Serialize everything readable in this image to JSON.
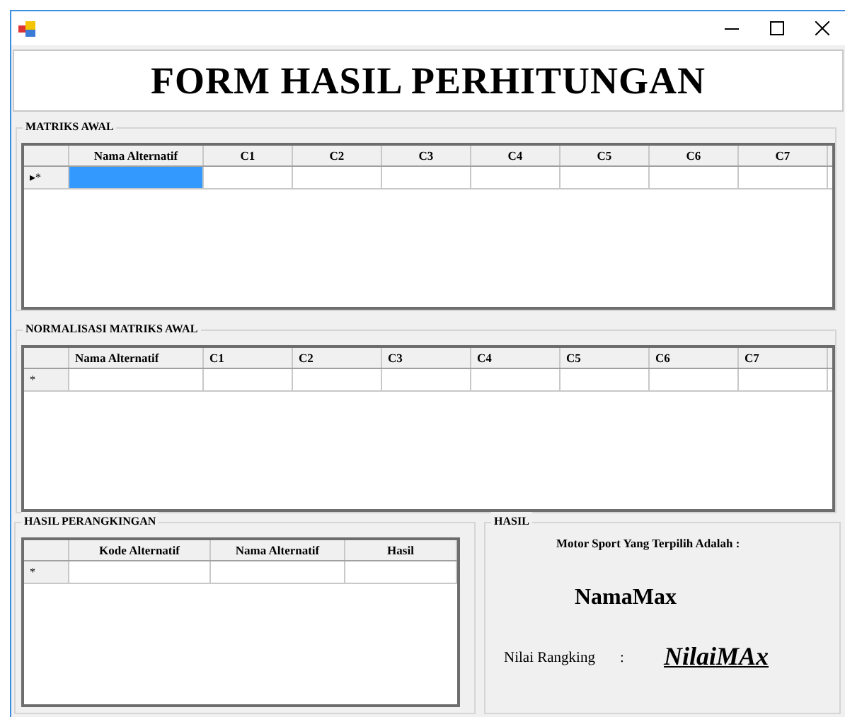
{
  "header": {
    "title": "FORM HASIL PERHITUNGAN"
  },
  "groups": [
    {
      "title": "MATRIKS AWAL",
      "headers_centered": true,
      "columns": [
        "Nama Alternatif",
        "C1",
        "C2",
        "C3",
        "C4",
        "C5",
        "C6",
        "C7"
      ],
      "rows": [
        {
          "indicator": "▸*",
          "cells": [
            {
              "selected": true
            },
            {
              "selected": false
            },
            {
              "selected": false
            },
            {
              "selected": false
            },
            {
              "selected": false
            },
            {
              "selected": false
            },
            {
              "selected": false
            },
            {
              "selected": false
            }
          ]
        }
      ]
    },
    {
      "title": "NORMALISASI MATRIKS AWAL",
      "headers_centered": false,
      "columns": [
        "Nama Alternatif",
        "C1",
        "C2",
        "C3",
        "C4",
        "C5",
        "C6",
        "C7"
      ],
      "rows": [
        {
          "indicator": "*",
          "cells": [
            {
              "selected": false
            },
            {
              "selected": false
            },
            {
              "selected": false
            },
            {
              "selected": false
            },
            {
              "selected": false
            },
            {
              "selected": false
            },
            {
              "selected": false
            },
            {
              "selected": false
            }
          ]
        }
      ]
    }
  ],
  "ranking": {
    "title": "HASIL PERANGKINGAN",
    "headers_centered": true,
    "columns": [
      "Kode Alternatif",
      "Nama Alternatif",
      "Hasil"
    ],
    "rows": [
      {
        "indicator": "*",
        "cells": [
          {
            "selected": false
          },
          {
            "selected": false
          },
          {
            "selected": false
          }
        ]
      }
    ]
  },
  "result": {
    "title": "HASIL",
    "caption": "Motor Sport Yang Terpilih Adalah :",
    "name": "NamaMax",
    "score_label": "Nilai Rangking",
    "separator": ":",
    "score": "NilaiMAx"
  }
}
